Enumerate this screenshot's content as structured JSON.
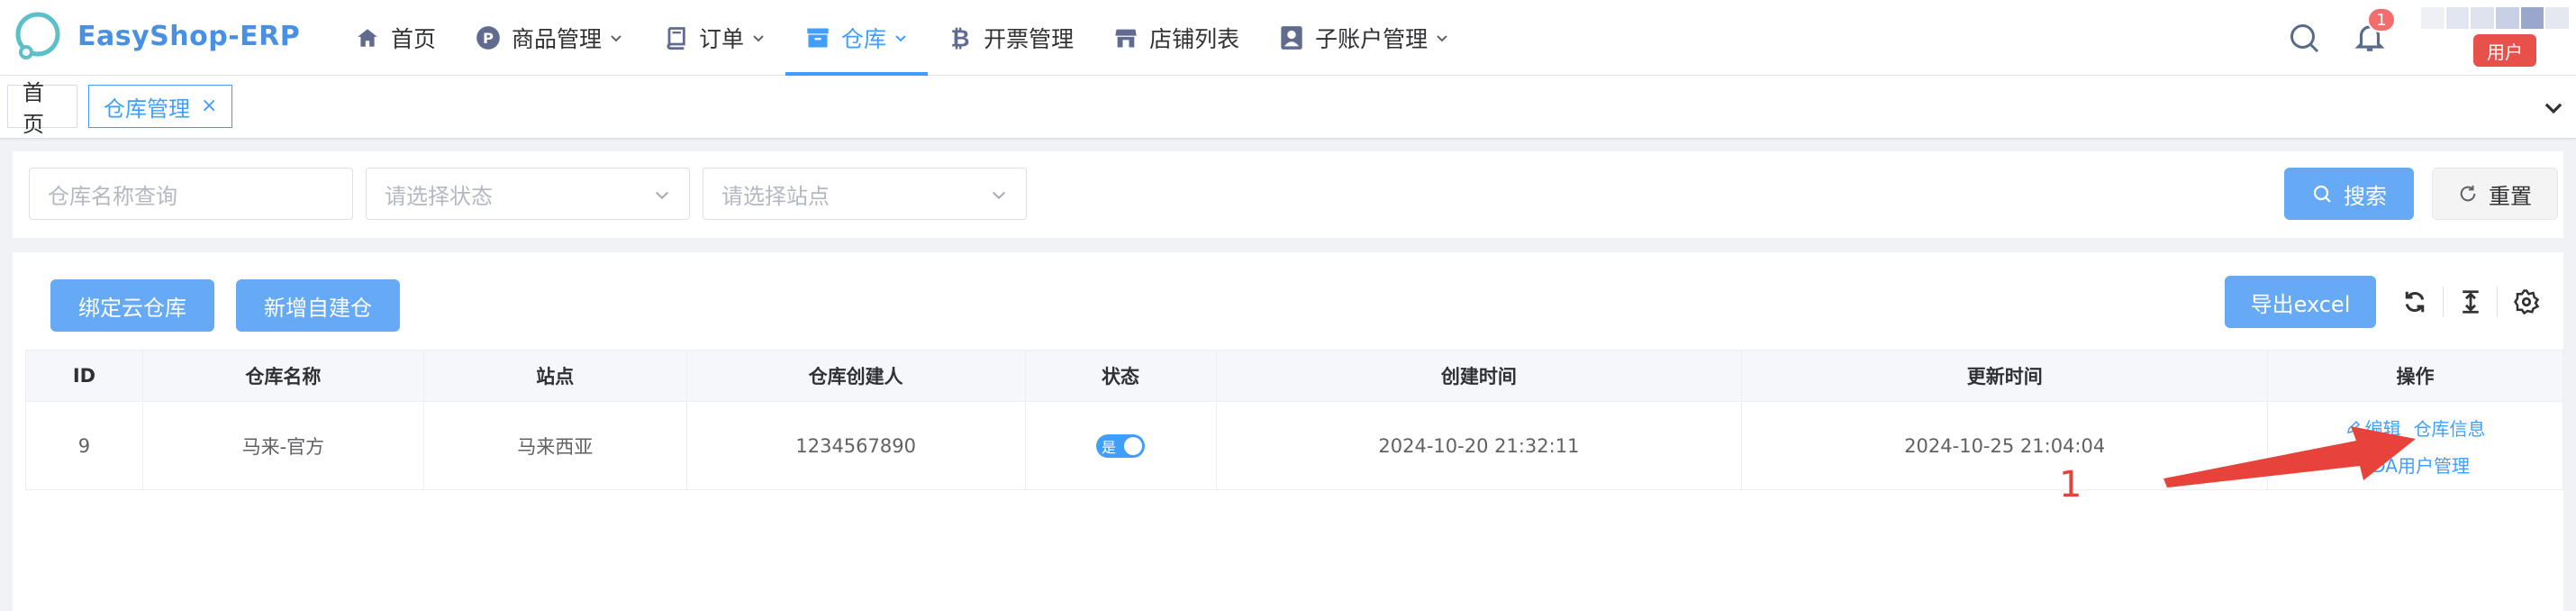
{
  "app": {
    "name": "EasyShop-ERP"
  },
  "nav": {
    "items": [
      {
        "label": "首页",
        "icon": "home-icon",
        "dropdown": false,
        "active": false
      },
      {
        "label": "商品管理",
        "icon": "product-p-icon",
        "dropdown": true,
        "active": false
      },
      {
        "label": "订单",
        "icon": "book-icon",
        "dropdown": true,
        "active": false
      },
      {
        "label": "仓库",
        "icon": "archive-box-icon",
        "dropdown": true,
        "active": true
      },
      {
        "label": "开票管理",
        "icon": "bitcoin-icon",
        "dropdown": false,
        "active": false
      },
      {
        "label": "店铺列表",
        "icon": "store-icon",
        "dropdown": false,
        "active": false
      },
      {
        "label": "子账户管理",
        "icon": "user-badge-icon",
        "dropdown": true,
        "active": false
      }
    ],
    "notification_count": "1",
    "user_label": "用户"
  },
  "tags": {
    "home": "首页",
    "active": "仓库管理",
    "close": "×"
  },
  "filters": {
    "name_placeholder": "仓库名称查询",
    "status_placeholder": "请选择状态",
    "site_placeholder": "请选择站点",
    "search_label": "搜索",
    "reset_label": "重置"
  },
  "toolbar": {
    "bind_cloud_label": "绑定云仓库",
    "add_own_label": "新增自建仓",
    "export_label": "导出excel"
  },
  "table": {
    "headers": [
      "ID",
      "仓库名称",
      "站点",
      "仓库创建人",
      "状态",
      "创建时间",
      "更新时间",
      "操作"
    ],
    "rows": [
      {
        "id": "9",
        "name": "马来-官方",
        "site": "马来西亚",
        "creator": "1234567890",
        "status_label": "是",
        "status_on": true,
        "created": "2024-10-20 21:32:11",
        "updated": "2024-10-25 21:04:04",
        "op_edit": "编辑",
        "op_info": "仓库信息",
        "op_pda": "PDA用户管理"
      }
    ]
  },
  "annotation": {
    "number": "1"
  },
  "colors": {
    "primary": "#409eff",
    "button_primary": "#66a9f5",
    "annotation_red": "#e8433a",
    "badge_red": "#f56c6c"
  }
}
